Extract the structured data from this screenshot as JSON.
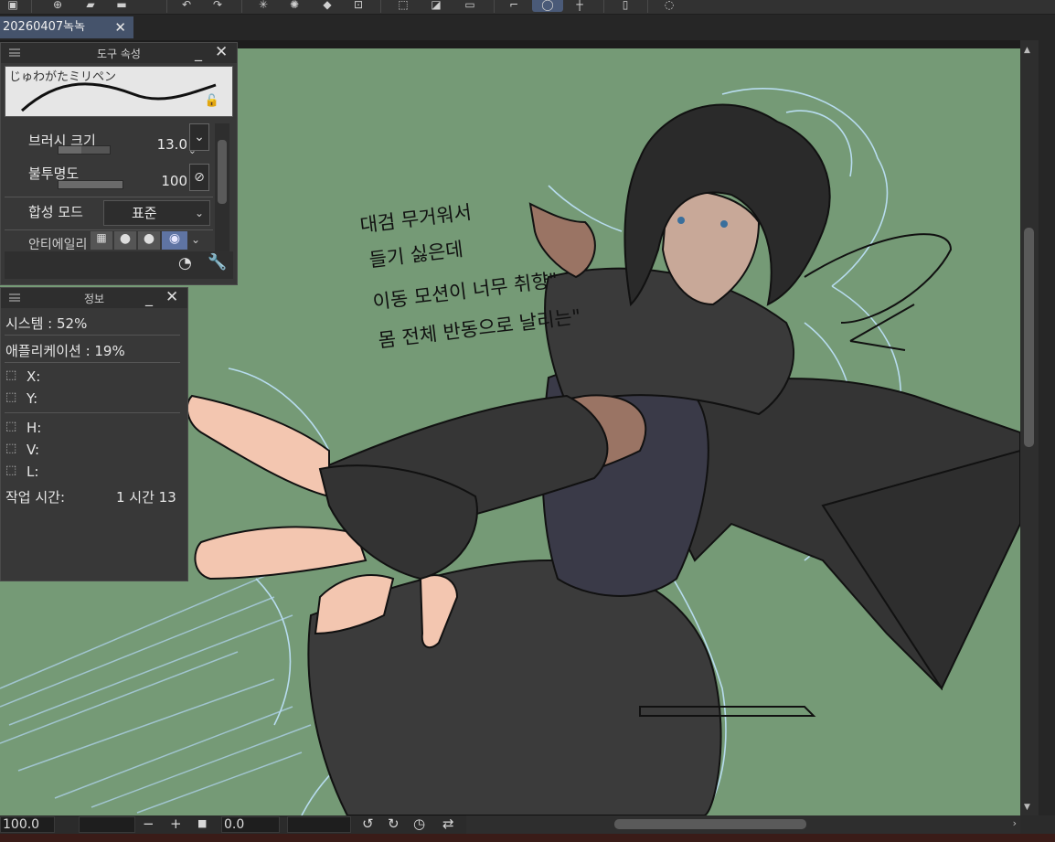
{
  "document": {
    "tab_title": "20260407녹녹",
    "tab_close": "✕"
  },
  "toolbar": {
    "icons": [
      "layers-icon",
      "new-canvas-icon",
      "open-folder-icon",
      "save-icon",
      "undo-icon",
      "redo-icon",
      "snap-radial-icon",
      "snap-burst-icon",
      "fill-icon",
      "transform-icon",
      "selection-off-icon",
      "clear-icon",
      "fill-selection-icon",
      "ruler-icon",
      "ellipse-snap-icon",
      "grid-icon",
      "device-icon",
      "chat-icon"
    ]
  },
  "tool_property": {
    "title": "도구 속성",
    "brush_name": "じゅわがたミリペン",
    "brush_size_label": "브러시 크기",
    "brush_size_value": "13.0",
    "brush_size_fill": 0.45,
    "opacity_label": "불투명도",
    "opacity_value": "100",
    "opacity_fill": 1.0,
    "blend_label": "합성 모드",
    "blend_value": "표준",
    "antialias_label": "안티에일리"
  },
  "info": {
    "title": "정보",
    "system": "시스템 : 52%",
    "application": "애플리케이션 : 19%",
    "x_label": "X:",
    "y_label": "Y:",
    "h_label": "H:",
    "v_label": "V:",
    "l_label": "L:",
    "work_time_label": "작업 시간:",
    "work_time_value": "1 시간 13"
  },
  "canvas": {
    "note_lines": [
      "대검 무거워서",
      "들기 싫은데",
      "이동 모션이 너무 취향\"",
      "몸 전체 반동으로 날리는\""
    ],
    "background": "#759a76"
  },
  "status": {
    "zoom": "100.0",
    "minus": "−",
    "plus": "+",
    "angle": "0.0"
  }
}
